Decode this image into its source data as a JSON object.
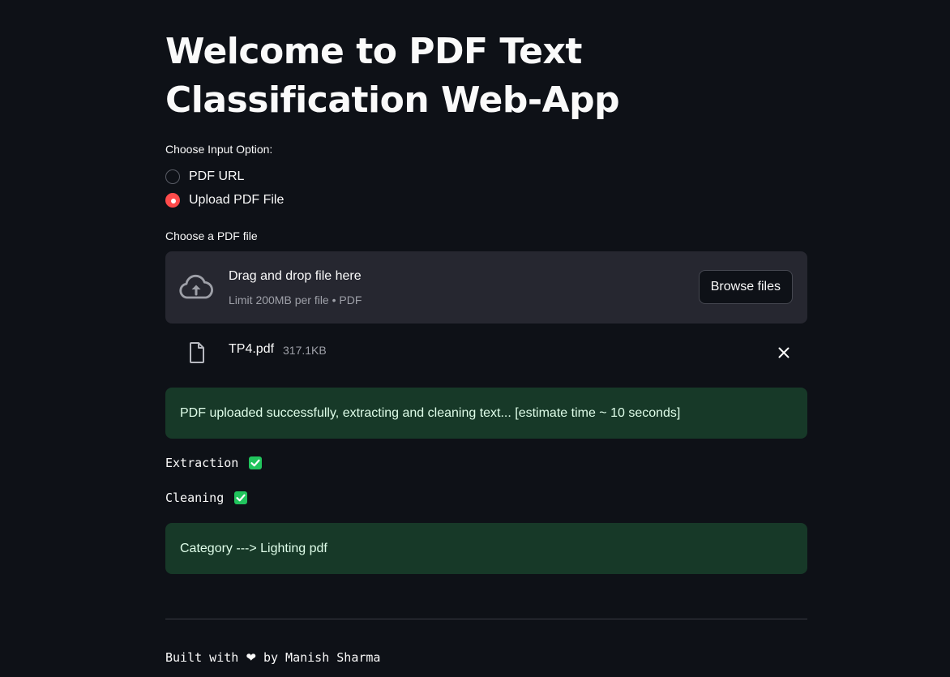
{
  "header": {
    "title": "Welcome to PDF Text Classification Web-App"
  },
  "input_option": {
    "label": "Choose Input Option:",
    "options": [
      {
        "label": "PDF URL",
        "selected": false
      },
      {
        "label": "Upload PDF File",
        "selected": true
      }
    ]
  },
  "uploader": {
    "label": "Choose a PDF file",
    "drop_title": "Drag and drop file here",
    "drop_limit": "Limit 200MB per file • PDF",
    "browse_label": "Browse files",
    "icon": "cloud-upload-icon",
    "file": {
      "name": "TP4.pdf",
      "size": "317.1KB",
      "icon": "file-icon"
    }
  },
  "status": {
    "upload_message": "PDF uploaded successfully, extracting and cleaning text... [estimate time ~ 10 seconds]",
    "steps": [
      {
        "label": "Extraction",
        "done": true
      },
      {
        "label": "Cleaning",
        "done": true
      }
    ],
    "result_message": "Category ---> Lighting pdf"
  },
  "footer": {
    "prefix": "Built with",
    "heart": "❤",
    "suffix": "by Manish Sharma"
  },
  "colors": {
    "background": "#0e1117",
    "accent": "#ff4b4b",
    "success_bg": "#173928",
    "success_text": "#dffde9",
    "check_green": "#21c45d",
    "panel": "#262730"
  }
}
